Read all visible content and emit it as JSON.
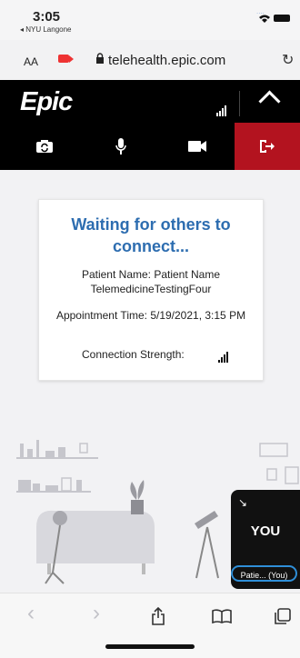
{
  "status_bar": {
    "time": "3:05",
    "carrier": "◂ NYU Langone",
    "signal_dots": "....",
    "icons": "▾ ▬"
  },
  "browser": {
    "text_size_label": "AA",
    "url": "telehealth.epic.com",
    "reload": "↻"
  },
  "app": {
    "logo": "Epic"
  },
  "card": {
    "title": "Waiting for others to connect...",
    "patient_name": "Patient Name: Patient Name TelemedicineTestingFour",
    "appointment_time": "Appointment Time: 5/19/2021, 3:15 PM",
    "connection_strength": "Connection Strength:"
  },
  "self_view": {
    "label": "YOU",
    "name_pill": "Patie... (You)",
    "expand_icon": "↘"
  },
  "bottom_bar": {
    "back": "‹",
    "forward": "›"
  },
  "colors": {
    "accent_blue": "#2d6db0",
    "leave_red": "#b3131f",
    "header_black": "#000000"
  }
}
